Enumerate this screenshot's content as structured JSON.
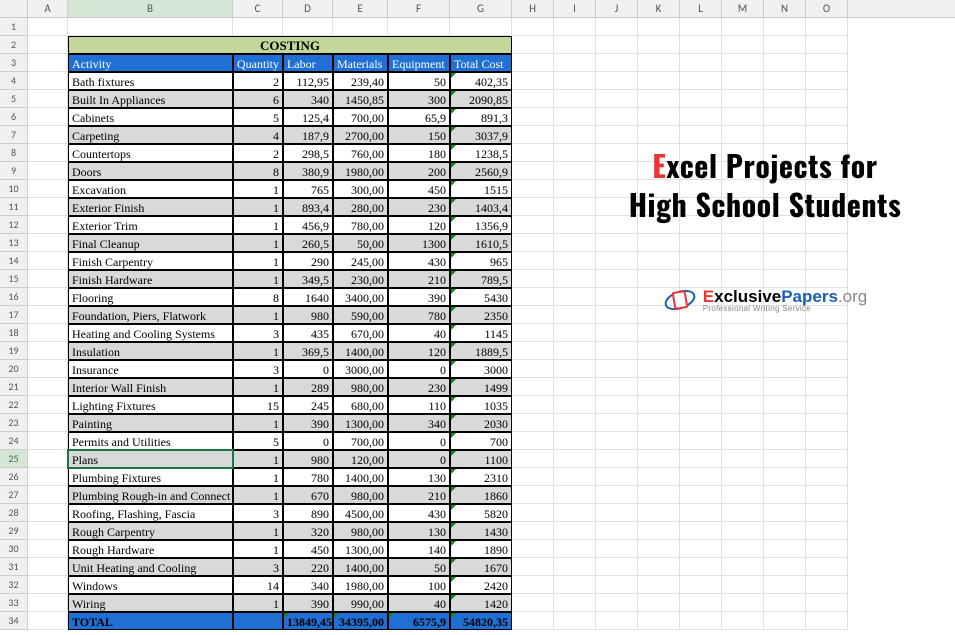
{
  "columns": [
    "A",
    "B",
    "C",
    "D",
    "E",
    "F",
    "G",
    "H",
    "I",
    "J",
    "K",
    "L",
    "M",
    "N",
    "O"
  ],
  "title": "COSTING",
  "headers": [
    "Activity",
    "Quantity",
    "Labor",
    "Materials",
    "Equipment",
    "Total Cost"
  ],
  "rows": [
    {
      "activity": "Bath fixtures",
      "q": "2",
      "l": "112,95",
      "m": "239,40",
      "e": "50",
      "t": "402,35",
      "shaded": false
    },
    {
      "activity": "Built In Appliances",
      "q": "6",
      "l": "340",
      "m": "1450,85",
      "e": "300",
      "t": "2090,85",
      "shaded": true
    },
    {
      "activity": "Cabinets",
      "q": "5",
      "l": "125,4",
      "m": "700,00",
      "e": "65,9",
      "t": "891,3",
      "shaded": false
    },
    {
      "activity": "Carpeting",
      "q": "4",
      "l": "187,9",
      "m": "2700,00",
      "e": "150",
      "t": "3037,9",
      "shaded": true
    },
    {
      "activity": "Countertops",
      "q": "2",
      "l": "298,5",
      "m": "760,00",
      "e": "180",
      "t": "1238,5",
      "shaded": false
    },
    {
      "activity": "Doors",
      "q": "8",
      "l": "380,9",
      "m": "1980,00",
      "e": "200",
      "t": "2560,9",
      "shaded": true
    },
    {
      "activity": "Excavation",
      "q": "1",
      "l": "765",
      "m": "300,00",
      "e": "450",
      "t": "1515",
      "shaded": false
    },
    {
      "activity": "Exterior Finish",
      "q": "1",
      "l": "893,4",
      "m": "280,00",
      "e": "230",
      "t": "1403,4",
      "shaded": true
    },
    {
      "activity": "Exterior Trim",
      "q": "1",
      "l": "456,9",
      "m": "780,00",
      "e": "120",
      "t": "1356,9",
      "shaded": false
    },
    {
      "activity": "Final Cleanup",
      "q": "1",
      "l": "260,5",
      "m": "50,00",
      "e": "1300",
      "t": "1610,5",
      "shaded": true
    },
    {
      "activity": "Finish Carpentry",
      "q": "1",
      "l": "290",
      "m": "245,00",
      "e": "430",
      "t": "965",
      "shaded": false
    },
    {
      "activity": "Finish Hardware",
      "q": "1",
      "l": "349,5",
      "m": "230,00",
      "e": "210",
      "t": "789,5",
      "shaded": true
    },
    {
      "activity": "Flooring",
      "q": "8",
      "l": "1640",
      "m": "3400,00",
      "e": "390",
      "t": "5430",
      "shaded": false
    },
    {
      "activity": "Foundation, Piers, Flatwork",
      "q": "1",
      "l": "980",
      "m": "590,00",
      "e": "780",
      "t": "2350",
      "shaded": true
    },
    {
      "activity": "Heating and Cooling Systems",
      "q": "3",
      "l": "435",
      "m": "670,00",
      "e": "40",
      "t": "1145",
      "shaded": false
    },
    {
      "activity": "Insulation",
      "q": "1",
      "l": "369,5",
      "m": "1400,00",
      "e": "120",
      "t": "1889,5",
      "shaded": true
    },
    {
      "activity": "Insurance",
      "q": "3",
      "l": "0",
      "m": "3000,00",
      "e": "0",
      "t": "3000",
      "shaded": false
    },
    {
      "activity": "Interior Wall Finish",
      "q": "1",
      "l": "289",
      "m": "980,00",
      "e": "230",
      "t": "1499",
      "shaded": true
    },
    {
      "activity": "Lighting Fixtures",
      "q": "15",
      "l": "245",
      "m": "680,00",
      "e": "110",
      "t": "1035",
      "shaded": false
    },
    {
      "activity": "Painting",
      "q": "1",
      "l": "390",
      "m": "1300,00",
      "e": "340",
      "t": "2030",
      "shaded": true
    },
    {
      "activity": "Permits and Utilities",
      "q": "5",
      "l": "0",
      "m": "700,00",
      "e": "0",
      "t": "700",
      "shaded": false
    },
    {
      "activity": "Plans",
      "q": "1",
      "l": "980",
      "m": "120,00",
      "e": "0",
      "t": "1100",
      "shaded": true,
      "selected": true
    },
    {
      "activity": "Plumbing Fixtures",
      "q": "1",
      "l": "780",
      "m": "1400,00",
      "e": "130",
      "t": "2310",
      "shaded": false
    },
    {
      "activity": "Plumbing Rough-in and Connect",
      "q": "1",
      "l": "670",
      "m": "980,00",
      "e": "210",
      "t": "1860",
      "shaded": true
    },
    {
      "activity": "Roofing, Flashing, Fascia",
      "q": "3",
      "l": "890",
      "m": "4500,00",
      "e": "430",
      "t": "5820",
      "shaded": false
    },
    {
      "activity": "Rough Carpentry",
      "q": "1",
      "l": "320",
      "m": "980,00",
      "e": "130",
      "t": "1430",
      "shaded": true
    },
    {
      "activity": "Rough Hardware",
      "q": "1",
      "l": "450",
      "m": "1300,00",
      "e": "140",
      "t": "1890",
      "shaded": false
    },
    {
      "activity": "Unit Heating and Cooling",
      "q": "3",
      "l": "220",
      "m": "1400,00",
      "e": "50",
      "t": "1670",
      "shaded": true
    },
    {
      "activity": "Windows",
      "q": "14",
      "l": "340",
      "m": "1980,00",
      "e": "100",
      "t": "2420",
      "shaded": false
    },
    {
      "activity": "Wiring",
      "q": "1",
      "l": "390",
      "m": "990,00",
      "e": "40",
      "t": "1420",
      "shaded": true
    }
  ],
  "total": {
    "label": "TOTAL",
    "l": "13849,45",
    "m": "34395,00",
    "e": "6575,9",
    "t": "54820,35"
  },
  "selected_row": 25,
  "selected_col": "B",
  "promo": {
    "line1_first": "E",
    "line1_rest": "xcel Projects for",
    "line2": "High School Students",
    "brand_e": "E",
    "brand_mid": "xclusive",
    "brand_p": "Papers",
    "brand_org": ".org",
    "brand_sub": "Professional Writing Service"
  }
}
